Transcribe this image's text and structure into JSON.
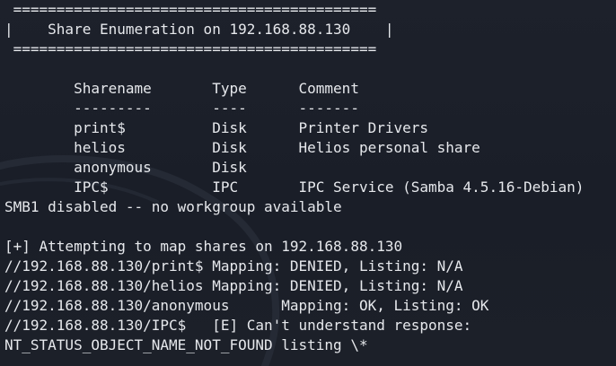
{
  "terminal": {
    "lines": [
      " ==========================================",
      "|    Share Enumeration on 192.168.88.130    |",
      " ==========================================",
      "",
      "        Sharename       Type      Comment",
      "        ---------       ----      -------",
      "        print$          Disk      Printer Drivers",
      "        helios          Disk      Helios personal share",
      "        anonymous       Disk",
      "        IPC$            IPC       IPC Service (Samba 4.5.16-Debian)",
      "SMB1 disabled -- no workgroup available",
      "",
      "[+] Attempting to map shares on 192.168.88.130",
      "//192.168.88.130/print$ Mapping: DENIED, Listing: N/A",
      "//192.168.88.130/helios Mapping: DENIED, Listing: N/A",
      "//192.168.88.130/anonymous      Mapping: OK, Listing: OK",
      "//192.168.88.130/IPC$   [E] Can't understand response:",
      "NT_STATUS_OBJECT_NAME_NOT_FOUND listing \\*"
    ]
  }
}
